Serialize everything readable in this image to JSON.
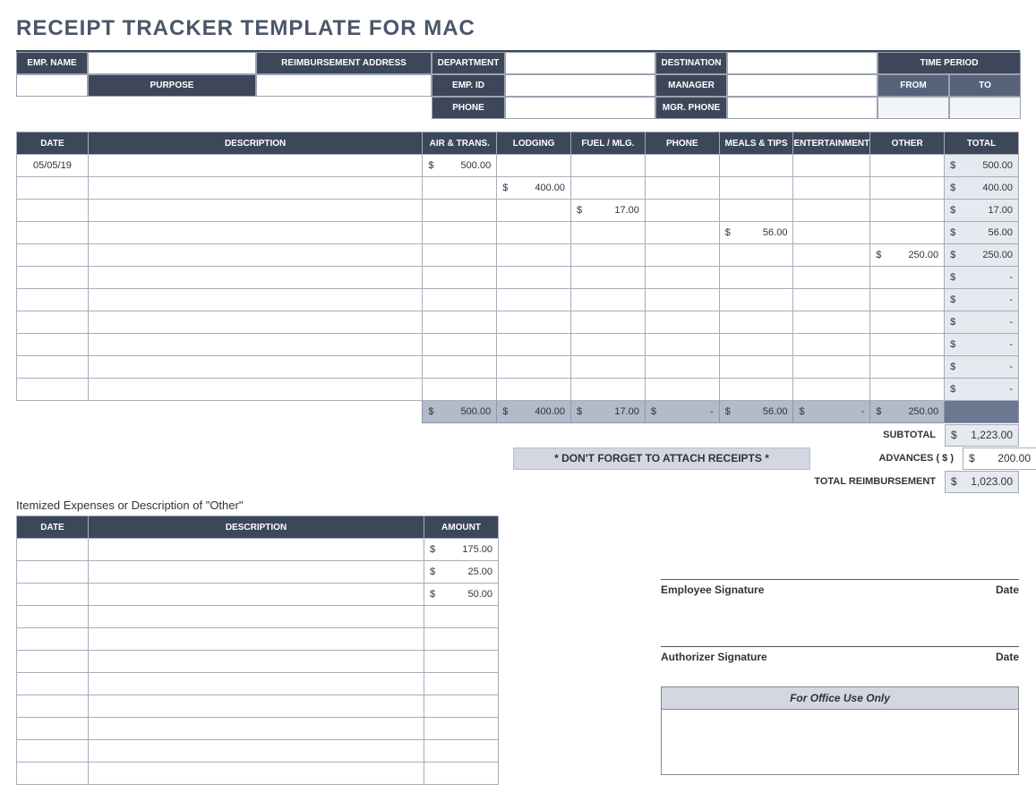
{
  "title": "RECEIPT TRACKER TEMPLATE FOR MAC",
  "header": {
    "emp_name_lab": "EMP. NAME",
    "reimb_addr_lab": "REIMBURSEMENT ADDRESS",
    "department_lab": "DEPARTMENT",
    "destination_lab": "DESTINATION",
    "time_period_lab": "TIME PERIOD",
    "emp_id_lab": "EMP. ID",
    "manager_lab": "MANAGER",
    "purpose_lab": "PURPOSE",
    "from_lab": "FROM",
    "to_lab": "TO",
    "phone_lab": "PHONE",
    "mgr_phone_lab": "MGR. PHONE"
  },
  "exp": {
    "cols": {
      "date": "DATE",
      "desc": "DESCRIPTION",
      "air": "AIR & TRANS.",
      "lodg": "LODGING",
      "fuel": "FUEL / MLG.",
      "phone": "PHONE",
      "meals": "MEALS & TIPS",
      "ent": "ENTERTAINMENT",
      "other": "OTHER",
      "total": "TOTAL"
    },
    "rows": [
      {
        "date": "05/05/19",
        "desc": "",
        "air": "500.00",
        "lodg": "",
        "fuel": "",
        "phone": "",
        "meals": "",
        "ent": "",
        "other": "",
        "total": "500.00"
      },
      {
        "date": "",
        "desc": "",
        "air": "",
        "lodg": "400.00",
        "fuel": "",
        "phone": "",
        "meals": "",
        "ent": "",
        "other": "",
        "total": "400.00"
      },
      {
        "date": "",
        "desc": "",
        "air": "",
        "lodg": "",
        "fuel": "17.00",
        "phone": "",
        "meals": "",
        "ent": "",
        "other": "",
        "total": "17.00"
      },
      {
        "date": "",
        "desc": "",
        "air": "",
        "lodg": "",
        "fuel": "",
        "phone": "",
        "meals": "56.00",
        "ent": "",
        "other": "",
        "total": "56.00"
      },
      {
        "date": "",
        "desc": "",
        "air": "",
        "lodg": "",
        "fuel": "",
        "phone": "",
        "meals": "",
        "ent": "",
        "other": "250.00",
        "total": "250.00"
      },
      {
        "date": "",
        "desc": "",
        "air": "",
        "lodg": "",
        "fuel": "",
        "phone": "",
        "meals": "",
        "ent": "",
        "other": "",
        "total": "-"
      },
      {
        "date": "",
        "desc": "",
        "air": "",
        "lodg": "",
        "fuel": "",
        "phone": "",
        "meals": "",
        "ent": "",
        "other": "",
        "total": "-"
      },
      {
        "date": "",
        "desc": "",
        "air": "",
        "lodg": "",
        "fuel": "",
        "phone": "",
        "meals": "",
        "ent": "",
        "other": "",
        "total": "-"
      },
      {
        "date": "",
        "desc": "",
        "air": "",
        "lodg": "",
        "fuel": "",
        "phone": "",
        "meals": "",
        "ent": "",
        "other": "",
        "total": "-"
      },
      {
        "date": "",
        "desc": "",
        "air": "",
        "lodg": "",
        "fuel": "",
        "phone": "",
        "meals": "",
        "ent": "",
        "other": "",
        "total": "-"
      },
      {
        "date": "",
        "desc": "",
        "air": "",
        "lodg": "",
        "fuel": "",
        "phone": "",
        "meals": "",
        "ent": "",
        "other": "",
        "total": "-"
      }
    ],
    "subtotals": {
      "air": "500.00",
      "lodg": "400.00",
      "fuel": "17.00",
      "phone": "-",
      "meals": "56.00",
      "ent": "-",
      "other": "250.00"
    }
  },
  "summary": {
    "subtotal_lab": "SUBTOTAL",
    "subtotal_val": "1,223.00",
    "advances_lab": "ADVANCES  ( $ )",
    "advances_val": "200.00",
    "totalreimb_lab": "TOTAL REIMBURSEMENT",
    "totalreimb_val": "1,023.00",
    "reminder": "* DON'T FORGET TO ATTACH RECEIPTS *"
  },
  "other_section": {
    "heading": "Itemized Expenses or Description of \"Other\"",
    "cols": {
      "date": "DATE",
      "desc": "DESCRIPTION",
      "amount": "AMOUNT"
    },
    "rows": [
      {
        "date": "",
        "desc": "",
        "amount": "175.00"
      },
      {
        "date": "",
        "desc": "",
        "amount": "25.00"
      },
      {
        "date": "",
        "desc": "",
        "amount": "50.00"
      },
      {
        "date": "",
        "desc": "",
        "amount": ""
      },
      {
        "date": "",
        "desc": "",
        "amount": ""
      },
      {
        "date": "",
        "desc": "",
        "amount": ""
      },
      {
        "date": "",
        "desc": "",
        "amount": ""
      },
      {
        "date": "",
        "desc": "",
        "amount": ""
      },
      {
        "date": "",
        "desc": "",
        "amount": ""
      },
      {
        "date": "",
        "desc": "",
        "amount": ""
      },
      {
        "date": "",
        "desc": "",
        "amount": ""
      }
    ]
  },
  "sig": {
    "emp": "Employee Signature",
    "auth": "Authorizer Signature",
    "date": "Date",
    "office": "For Office Use Only"
  }
}
